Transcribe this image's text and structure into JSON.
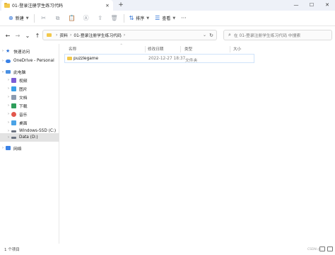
{
  "window": {
    "tab_title": "01-登录注册学生练习代码",
    "close_tab": "✕",
    "new_tab": "+",
    "minimize": "—",
    "maximize": "☐",
    "close": "✕"
  },
  "toolbar": {
    "new_label": "新建",
    "sort_label": "排序",
    "view_label": "查看",
    "more_label": "···"
  },
  "address": {
    "crumbs": [
      "资料",
      "01-登录注册学生练习代码"
    ],
    "search_placeholder": "在 01-登录注册学生练习代码 中搜索"
  },
  "sidebar": {
    "items": [
      {
        "label": "快速访问"
      },
      {
        "label": "OneDrive - Personal"
      },
      {
        "label": "此电脑"
      },
      {
        "label": "视频"
      },
      {
        "label": "图片"
      },
      {
        "label": "文档"
      },
      {
        "label": "下载"
      },
      {
        "label": "音乐"
      },
      {
        "label": "桌面"
      },
      {
        "label": "Windows-SSD (C:)"
      },
      {
        "label": "Data (D:)"
      },
      {
        "label": "网络"
      }
    ]
  },
  "columns": {
    "name": "名称",
    "date": "修改日期",
    "type": "类型",
    "size": "大小"
  },
  "files": [
    {
      "name": "puzzlegame",
      "date": "2022-12-27 18:37",
      "type": "文件夹",
      "size": ""
    }
  ],
  "status": {
    "count": "1 个项目",
    "watermark": "CSDN @..."
  }
}
